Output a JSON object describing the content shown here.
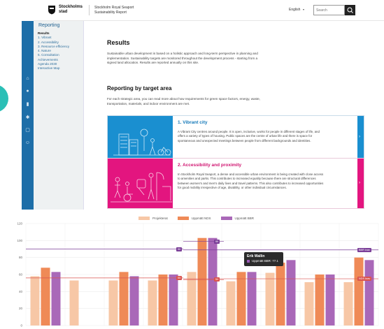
{
  "header": {
    "logo_line1": "Stockholms",
    "logo_line2": "stad",
    "sub_line1": "Stockholm Royal Seaport",
    "sub_line2": "Sustainability Report",
    "language": "English",
    "search_placeholder": "Search"
  },
  "sidebar": {
    "title": "Reporting",
    "items": [
      {
        "label": "Results",
        "active": true
      },
      {
        "label": "1. Vibrant"
      },
      {
        "label": "2. Accessibility"
      },
      {
        "label": "3. Resource efficiency"
      },
      {
        "label": "4. Nature"
      },
      {
        "label": "5. Consultation"
      },
      {
        "label": "Achievements"
      },
      {
        "label": "Agenda 2030"
      },
      {
        "label": "Interactive Map"
      }
    ]
  },
  "main": {
    "title": "Results",
    "intro": "Sustainable urban development is based on a holistic approach and long-term perspective in planning and implementation. Sustainability targets are monitored throughout the development process - starting from a signed land allocation. Results are reported annually on this site.",
    "section_title": "Reporting by target area",
    "section_intro": "For each strategic area, you can read more about how requirements for green space factors, energy, waste, transportation, materials, and indoor environment are met.",
    "cards": [
      {
        "title": "1. Vibrant city",
        "text": "A Vibrant City centres around people. It is open, inclusive, works for people in different stages of life, and offers a variety of types of housing. Public spaces are the centre of urban life and there is space for spontaneous and unexpected meetings between people from different backgrounds and identities.",
        "color": "#1a8fd0"
      },
      {
        "title": "2. Accessibility and proximity",
        "text": "In Stockholm Royal Seaport, a dense and accessible urban environment is being created with close access to amenities and parks. This contributes to increased equality because there are structural differences between women's and men's daily lives and travel patterns. This also contributes to increased opportunities for good mobility irrespective of age, disability, or other individual circumstances.",
        "color": "#e3157f"
      }
    ]
  },
  "chart_data": {
    "type": "bar",
    "ylim": [
      0,
      120
    ],
    "yticks": [
      0,
      20,
      40,
      60,
      80,
      100,
      120
    ],
    "series": [
      {
        "name": "Projekterat",
        "color": "#f7c7a6",
        "values": [
          58,
          53,
          53,
          53,
          63,
          52,
          62,
          51,
          51
        ]
      },
      {
        "name": "Uppmätt NDS",
        "color": "#ef8a57",
        "values": [
          68,
          null,
          63,
          60,
          103,
          63,
          74,
          60,
          80
        ]
      },
      {
        "name": "Uppmätt BBR",
        "color": "#a968b8",
        "values": [
          63,
          null,
          58,
          60,
          103,
          63,
          77,
          60,
          77
        ]
      }
    ],
    "reference_lines": [
      {
        "value": 90,
        "color": "#7b3f98",
        "side": "left",
        "label": "90"
      },
      {
        "value": 89,
        "color": "#7b3f98",
        "side": "right",
        "label": "BBR krav"
      },
      {
        "value": 56,
        "color": "#d9534f",
        "side": "left",
        "label": "55"
      },
      {
        "value": 55,
        "color": "#d9534f",
        "side": "right",
        "label": "NDS krav"
      },
      {
        "value": 99,
        "color": "#7b3f98",
        "side": "mid",
        "label": "99"
      },
      {
        "value": 54,
        "color": "#d9534f",
        "side": "mid2",
        "label": "54"
      }
    ],
    "tooltip": {
      "title": "Erik Wallin",
      "series": "Uppmätt BBR",
      "value": 77.1,
      "label": "Uppmätt BBR: 77.1"
    }
  }
}
